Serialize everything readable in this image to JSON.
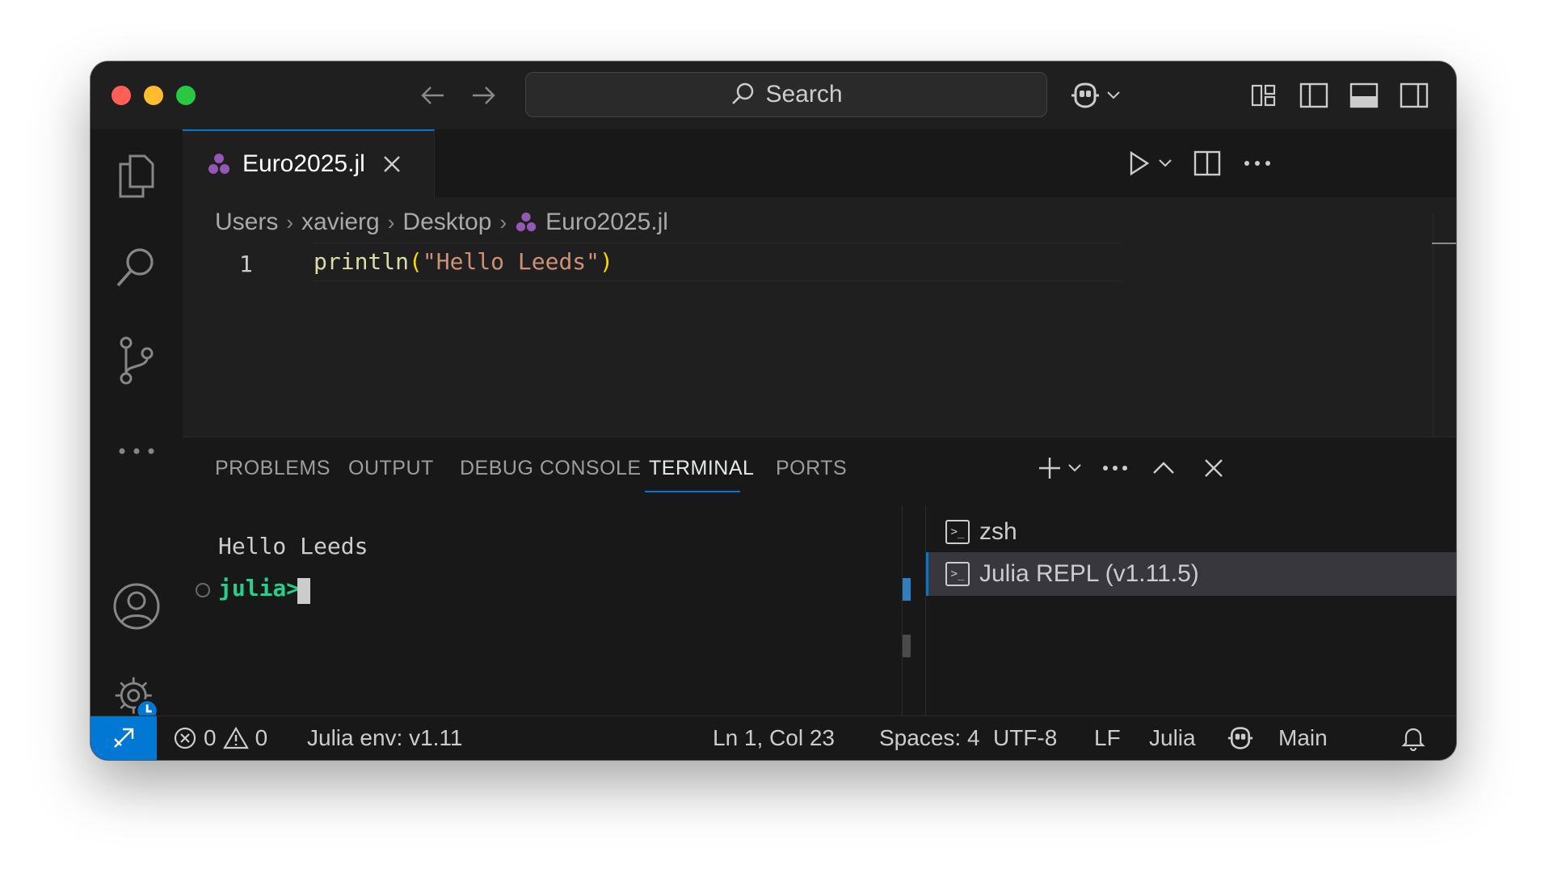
{
  "titlebar": {
    "search_placeholder": "Search",
    "traffic_lights": {
      "close": "#ff5f57",
      "minimize": "#febc2e",
      "maximize": "#28c840"
    }
  },
  "editor": {
    "tab_label": "Euro2025.jl",
    "breadcrumb": [
      "Users",
      "xavierg",
      "Desktop",
      "Euro2025.jl"
    ],
    "line_number": "1",
    "code": {
      "func": "println",
      "open": "(",
      "string": "\"Hello Leeds\"",
      "close": ")"
    }
  },
  "panel": {
    "tabs": [
      "PROBLEMS",
      "OUTPUT",
      "DEBUG CONSOLE",
      "TERMINAL",
      "PORTS"
    ],
    "active_tab": "TERMINAL",
    "terminal_output": "Hello Leeds",
    "prompt": "julia>",
    "terminals": [
      "zsh",
      "Julia REPL (v1.11.5)"
    ]
  },
  "statusbar": {
    "errors": "0",
    "warnings": "0",
    "julia_env": "Julia env: v1.11",
    "position": "Ln 1, Col 23",
    "spaces": "Spaces: 4",
    "encoding": "UTF-8",
    "eol": "LF",
    "language": "Julia",
    "branch": "Main"
  },
  "colors": {
    "accent": "#0078d4",
    "julia_prompt": "#23d18b",
    "code_func": "#dcdcaa",
    "code_string": "#ce9178",
    "code_paren": "#ffd700",
    "julia_logo": "#9558b2"
  }
}
